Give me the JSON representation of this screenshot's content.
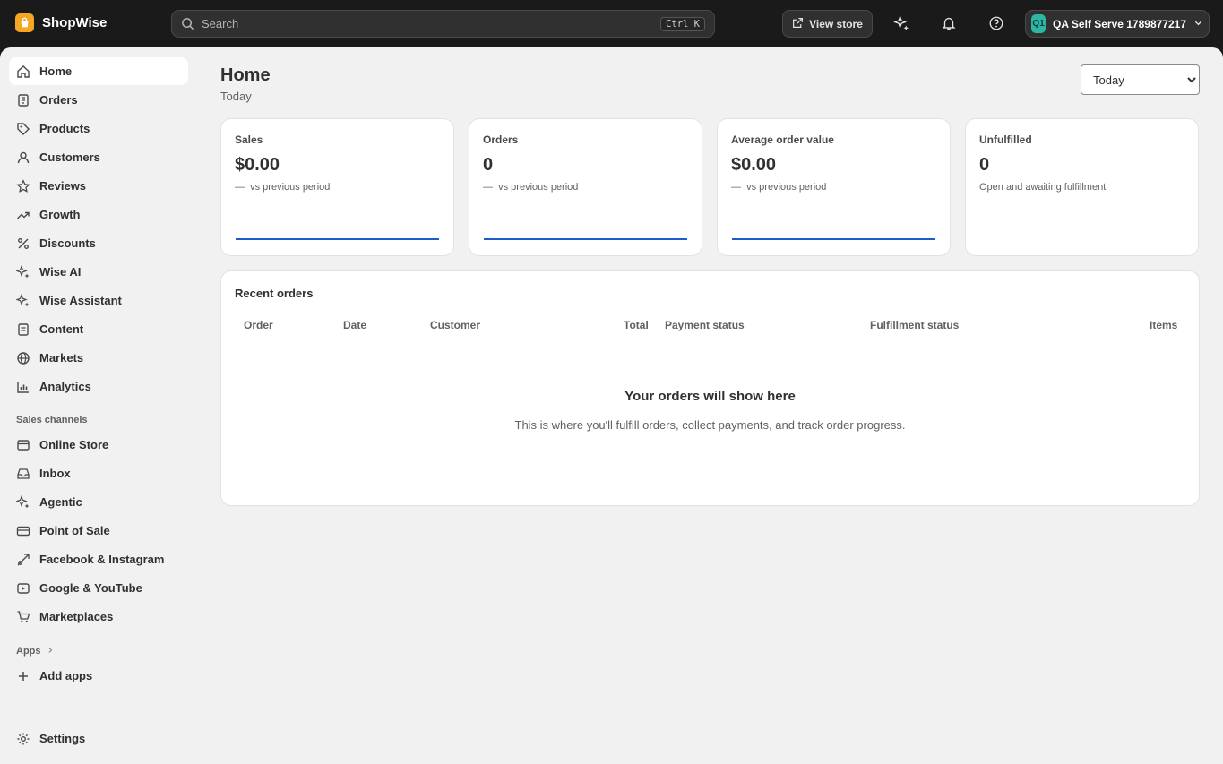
{
  "header": {
    "brand": "ShopWise",
    "search_placeholder": "Search",
    "search_shortcut": "Ctrl K",
    "view_store_label": "View store",
    "account_initials": "Q1",
    "account_name": "QA Self Serve 1789877217"
  },
  "sidebar": {
    "items": [
      {
        "label": "Home",
        "icon": "home-icon",
        "active": true
      },
      {
        "label": "Orders",
        "icon": "orders-icon"
      },
      {
        "label": "Products",
        "icon": "tag-icon"
      },
      {
        "label": "Customers",
        "icon": "person-icon"
      },
      {
        "label": "Reviews",
        "icon": "star-icon"
      },
      {
        "label": "Growth",
        "icon": "trending-icon"
      },
      {
        "label": "Discounts",
        "icon": "discount-icon"
      },
      {
        "label": "Wise AI",
        "icon": "sparkle-icon"
      },
      {
        "label": "Wise Assistant",
        "icon": "sparkle-icon"
      },
      {
        "label": "Content",
        "icon": "document-icon"
      },
      {
        "label": "Markets",
        "icon": "globe-icon"
      },
      {
        "label": "Analytics",
        "icon": "chart-icon"
      }
    ],
    "sales_channels_label": "Sales channels",
    "channels": [
      {
        "label": "Online Store",
        "icon": "store-icon"
      },
      {
        "label": "Inbox",
        "icon": "inbox-icon"
      },
      {
        "label": "Agentic",
        "icon": "sparkle-icon"
      },
      {
        "label": "Point of Sale",
        "icon": "pos-icon"
      },
      {
        "label": "Facebook & Instagram",
        "icon": "social-icon"
      },
      {
        "label": "Google & YouTube",
        "icon": "video-icon"
      },
      {
        "label": "Marketplaces",
        "icon": "cart-icon"
      }
    ],
    "apps_label": "Apps",
    "add_apps_label": "Add apps",
    "settings_label": "Settings"
  },
  "main": {
    "title": "Home",
    "subtitle": "Today",
    "period_select": {
      "selected": "Today",
      "options": [
        "Today"
      ]
    },
    "metrics": [
      {
        "title": "Sales",
        "value": "$0.00",
        "note_dash": "—",
        "note": "vs previous period"
      },
      {
        "title": "Orders",
        "value": "0",
        "note_dash": "—",
        "note": "vs previous period"
      },
      {
        "title": "Average order value",
        "value": "$0.00",
        "note_dash": "—",
        "note": "vs previous period"
      },
      {
        "title": "Unfulfilled",
        "value": "0",
        "note_dash": "",
        "note": "Open and awaiting fulfillment"
      }
    ],
    "recent_orders": {
      "title": "Recent orders",
      "columns": [
        "Order",
        "Date",
        "Customer",
        "Total",
        "Payment status",
        "Fulfillment status",
        "Items"
      ],
      "empty_title": "Your orders will show here",
      "empty_text": "This is where you'll fulfill orders, collect payments, and track order progress."
    }
  },
  "colors": {
    "accent": "#1f5bc6",
    "topbar": "#1a1a1a",
    "background": "#f1f1f1",
    "brand": "#f5a623"
  }
}
